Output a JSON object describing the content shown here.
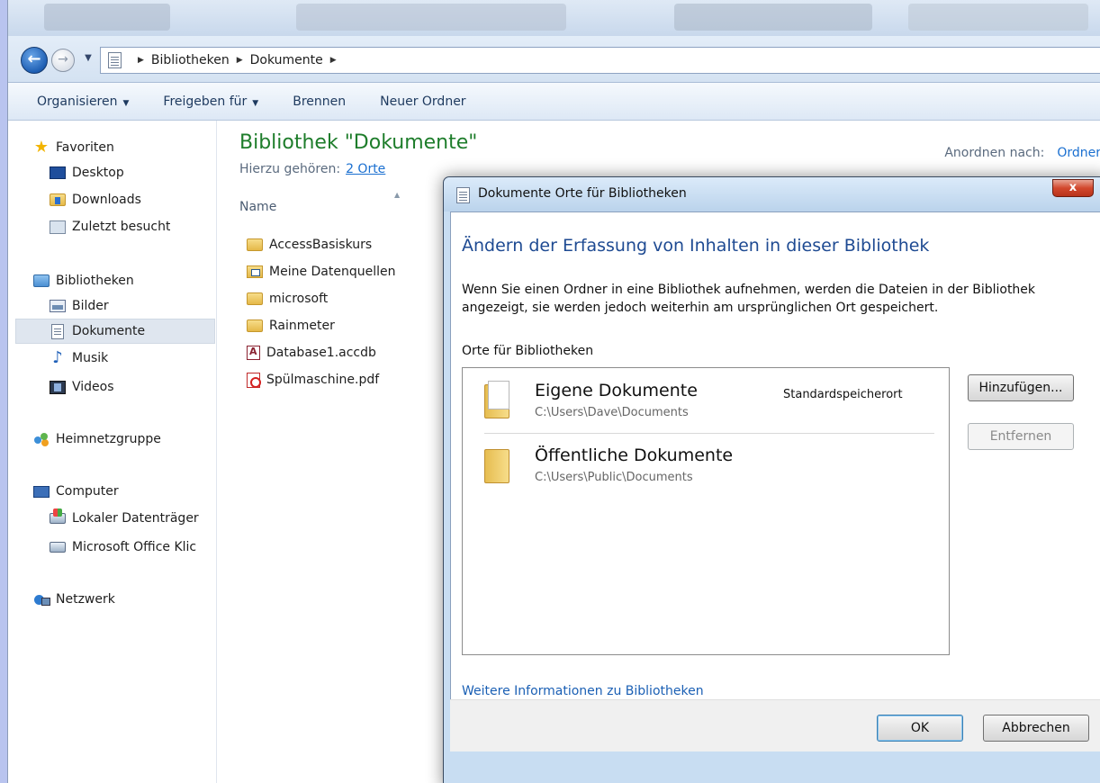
{
  "address": {
    "crumbs": [
      "Bibliotheken",
      "Dokumente"
    ]
  },
  "toolbar": {
    "organize": "Organisieren",
    "share": "Freigeben für",
    "burn": "Brennen",
    "new_folder": "Neuer Ordner"
  },
  "nav": {
    "favorites": "Favoriten",
    "desktop": "Desktop",
    "downloads": "Downloads",
    "recent": "Zuletzt besucht",
    "libraries": "Bibliotheken",
    "pictures": "Bilder",
    "documents": "Dokumente",
    "music": "Musik",
    "videos": "Videos",
    "homegroup": "Heimnetzgruppe",
    "computer": "Computer",
    "local_disk": "Lokaler Datenträger",
    "office_drive": "Microsoft Office Klic",
    "network": "Netzwerk"
  },
  "content": {
    "title": "Bibliothek \"Dokumente\"",
    "includes_label": "Hierzu gehören:",
    "includes_link": "2 Orte",
    "arrange_label": "Anordnen nach:",
    "arrange_value": "Ordner",
    "column_name": "Name",
    "files": [
      "AccessBasiskurs",
      "Meine Datenquellen",
      "microsoft",
      "Rainmeter",
      "Database1.accdb",
      "Spülmaschine.pdf"
    ]
  },
  "dialog": {
    "title": "Dokumente Orte für Bibliotheken",
    "close": "x",
    "heading": "Ändern der Erfassung von Inhalten in dieser Bibliothek",
    "description": "Wenn Sie einen Ordner in eine Bibliothek aufnehmen, werden die Dateien in der Bibliothek angezeigt, sie werden jedoch weiterhin am ursprünglichen Ort gespeichert.",
    "locations_label": "Orte für Bibliotheken",
    "locations": [
      {
        "name": "Eigene Dokumente",
        "path": "C:\\Users\\Dave\\Documents",
        "tag": "Standardspeicherort"
      },
      {
        "name": "Öffentliche Dokumente",
        "path": "C:\\Users\\Public\\Documents"
      }
    ],
    "add_button": "Hinzufügen...",
    "remove_button": "Entfernen",
    "more_info_link": "Weitere Informationen zu Bibliotheken",
    "ok_button": "OK",
    "cancel_button": "Abbrechen"
  }
}
